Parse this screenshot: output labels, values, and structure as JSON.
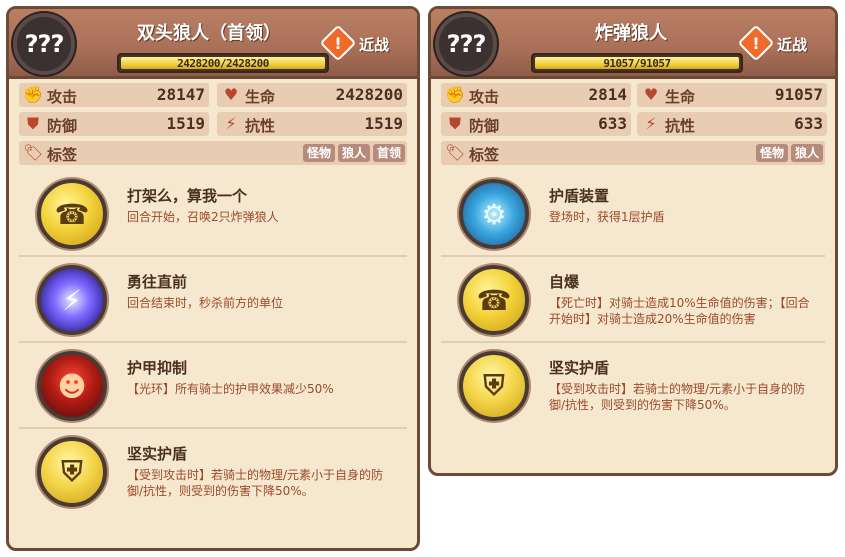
{
  "cards": [
    {
      "badge": "???",
      "title": "双头狼人（首领）",
      "hp_text": "2428200/2428200",
      "hp_fraction": 1.0,
      "attack_type": "近战",
      "stats": {
        "attack_label": "攻击",
        "attack_value": "28147",
        "hp_label": "生命",
        "hp_value": "2428200",
        "defense_label": "防御",
        "defense_value": "1519",
        "resist_label": "抗性",
        "resist_value": "1519",
        "tags_label": "标签",
        "tags": [
          "怪物",
          "狼人",
          "首领"
        ]
      },
      "skills": [
        {
          "name": "打架么，算我一个",
          "desc": "回合开始，召唤2只炸弹狼人",
          "icon": "phone-icon"
        },
        {
          "name": "勇往直前",
          "desc": "回合结束时，秒杀前方的单位",
          "icon": "slash-icon"
        },
        {
          "name": "护甲抑制",
          "desc": "【光环】所有骑士的护甲效果减少50%",
          "icon": "red-hood-icon"
        },
        {
          "name": "坚实护盾",
          "desc": "【受到攻击时】若骑士的物理/元素小于自身的防御/抗性，则受到的伤害下降50%。",
          "icon": "shield-icon"
        }
      ]
    },
    {
      "badge": "???",
      "title": "炸弹狼人",
      "hp_text": "91057/91057",
      "hp_fraction": 1.0,
      "attack_type": "近战",
      "stats": {
        "attack_label": "攻击",
        "attack_value": "2814",
        "hp_label": "生命",
        "hp_value": "91057",
        "defense_label": "防御",
        "defense_value": "633",
        "resist_label": "抗性",
        "resist_value": "633",
        "tags_label": "标签",
        "tags": [
          "怪物",
          "狼人"
        ]
      },
      "skills": [
        {
          "name": "护盾装置",
          "desc": "登场时，获得1层护盾",
          "icon": "gear-icon"
        },
        {
          "name": "自爆",
          "desc": "【死亡时】对骑士造成10%生命值的伤害；【回合开始时】对骑士造成20%生命值的伤害",
          "icon": "phone-icon"
        },
        {
          "name": "坚实护盾",
          "desc": "【受到攻击时】若骑士的物理/元素小于自身的防御/抗性，则受到的伤害下降50%。",
          "icon": "shield-icon"
        }
      ]
    }
  ]
}
